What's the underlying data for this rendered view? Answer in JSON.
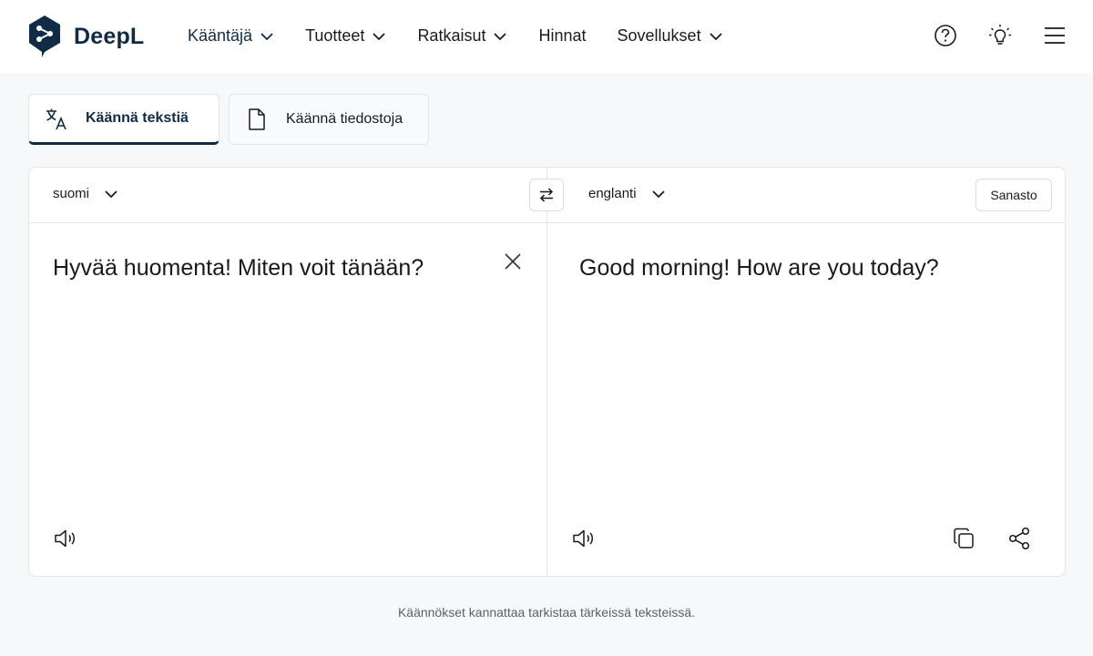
{
  "brand": {
    "name": "DeepL",
    "color": "#0f2b46"
  },
  "nav": {
    "items": [
      {
        "label": "Kääntäjä",
        "has_dropdown": true,
        "active": true
      },
      {
        "label": "Tuotteet",
        "has_dropdown": true
      },
      {
        "label": "Ratkaisut",
        "has_dropdown": true
      },
      {
        "label": "Hinnat",
        "has_dropdown": false
      },
      {
        "label": "Sovellukset",
        "has_dropdown": true
      }
    ],
    "icons": [
      "help-icon",
      "lightbulb-icon",
      "menu-icon"
    ]
  },
  "tabs": {
    "text_label": "Käännä tekstiä",
    "file_label": "Käännä tiedostoja"
  },
  "translator": {
    "source_lang": "suomi",
    "target_lang": "englanti",
    "glossary_label": "Sanasto",
    "source_text": "Hyvää huomenta! Miten voit tänään?",
    "target_text": "Good morning! How are you today?"
  },
  "footer_note": "Käännökset kannattaa tarkistaa tärkeissä teksteissä."
}
